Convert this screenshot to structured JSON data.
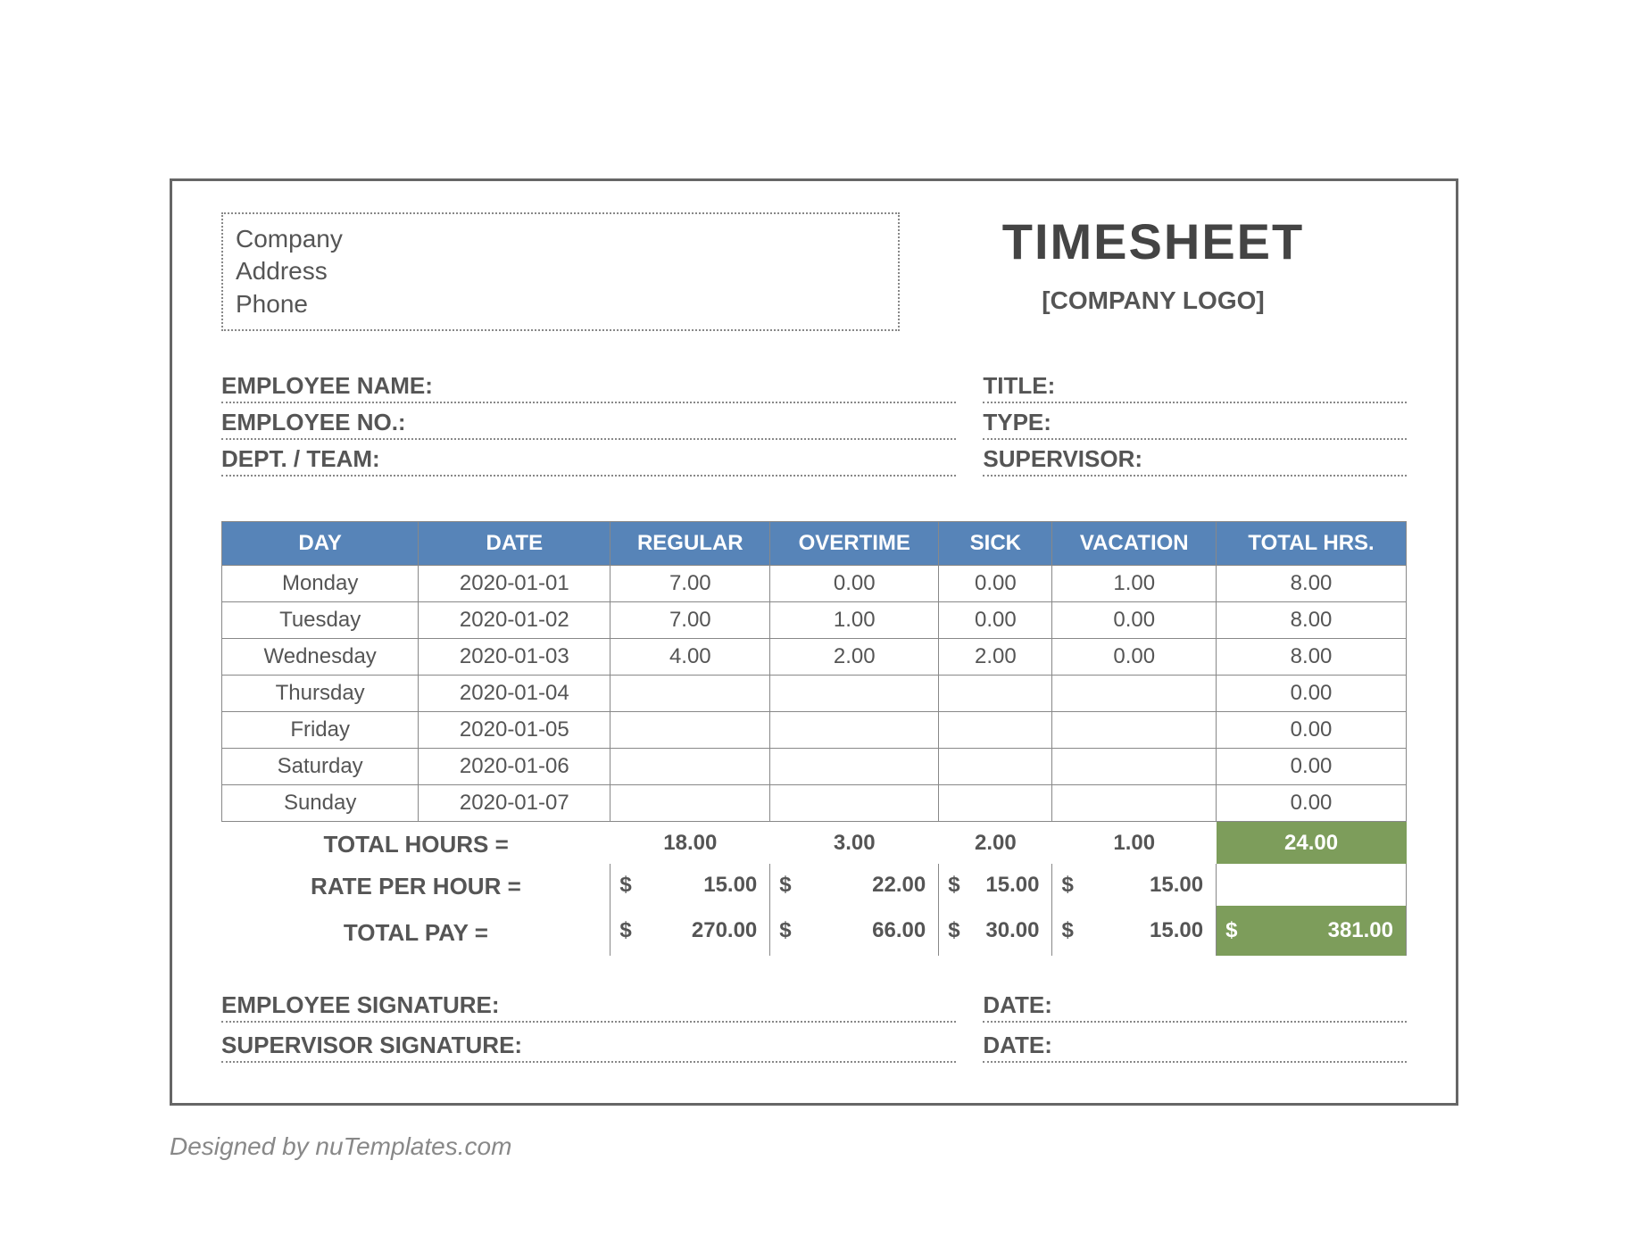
{
  "header": {
    "company_line1": "Company",
    "company_line2": "Address",
    "company_line3": "Phone",
    "title": "TIMESHEET",
    "logo_text": "[COMPANY LOGO]"
  },
  "meta": {
    "left": [
      {
        "label": "EMPLOYEE NAME:"
      },
      {
        "label": "EMPLOYEE NO.:"
      },
      {
        "label": "DEPT. / TEAM:"
      }
    ],
    "right": [
      {
        "label": "TITLE:"
      },
      {
        "label": "TYPE:"
      },
      {
        "label": "SUPERVISOR:"
      }
    ]
  },
  "table": {
    "headers": [
      "DAY",
      "DATE",
      "REGULAR",
      "OVERTIME",
      "SICK",
      "VACATION",
      "TOTAL HRS."
    ],
    "rows": [
      {
        "day": "Monday",
        "date": "2020-01-01",
        "regular": "7.00",
        "overtime": "0.00",
        "sick": "0.00",
        "vacation": "1.00",
        "total": "8.00"
      },
      {
        "day": "Tuesday",
        "date": "2020-01-02",
        "regular": "7.00",
        "overtime": "1.00",
        "sick": "0.00",
        "vacation": "0.00",
        "total": "8.00"
      },
      {
        "day": "Wednesday",
        "date": "2020-01-03",
        "regular": "4.00",
        "overtime": "2.00",
        "sick": "2.00",
        "vacation": "0.00",
        "total": "8.00"
      },
      {
        "day": "Thursday",
        "date": "2020-01-04",
        "regular": "",
        "overtime": "",
        "sick": "",
        "vacation": "",
        "total": "0.00"
      },
      {
        "day": "Friday",
        "date": "2020-01-05",
        "regular": "",
        "overtime": "",
        "sick": "",
        "vacation": "",
        "total": "0.00"
      },
      {
        "day": "Saturday",
        "date": "2020-01-06",
        "regular": "",
        "overtime": "",
        "sick": "",
        "vacation": "",
        "total": "0.00"
      },
      {
        "day": "Sunday",
        "date": "2020-01-07",
        "regular": "",
        "overtime": "",
        "sick": "",
        "vacation": "",
        "total": "0.00"
      }
    ],
    "total_hours_label": "TOTAL HOURS =",
    "total_hours": {
      "regular": "18.00",
      "overtime": "3.00",
      "sick": "2.00",
      "vacation": "1.00",
      "total": "24.00"
    },
    "rate_label": "RATE PER HOUR =",
    "rate": {
      "regular": "15.00",
      "overtime": "22.00",
      "sick": "15.00",
      "vacation": "15.00",
      "total": ""
    },
    "pay_label": "TOTAL PAY =",
    "pay": {
      "regular": "270.00",
      "overtime": "66.00",
      "sick": "30.00",
      "vacation": "15.00",
      "total": "381.00"
    },
    "currency": "$"
  },
  "signatures": {
    "left": [
      {
        "label": "EMPLOYEE SIGNATURE:"
      },
      {
        "label": "SUPERVISOR SIGNATURE:"
      }
    ],
    "right": [
      {
        "label": "DATE:"
      },
      {
        "label": "DATE:"
      }
    ]
  },
  "credit": "Designed by nuTemplates.com"
}
